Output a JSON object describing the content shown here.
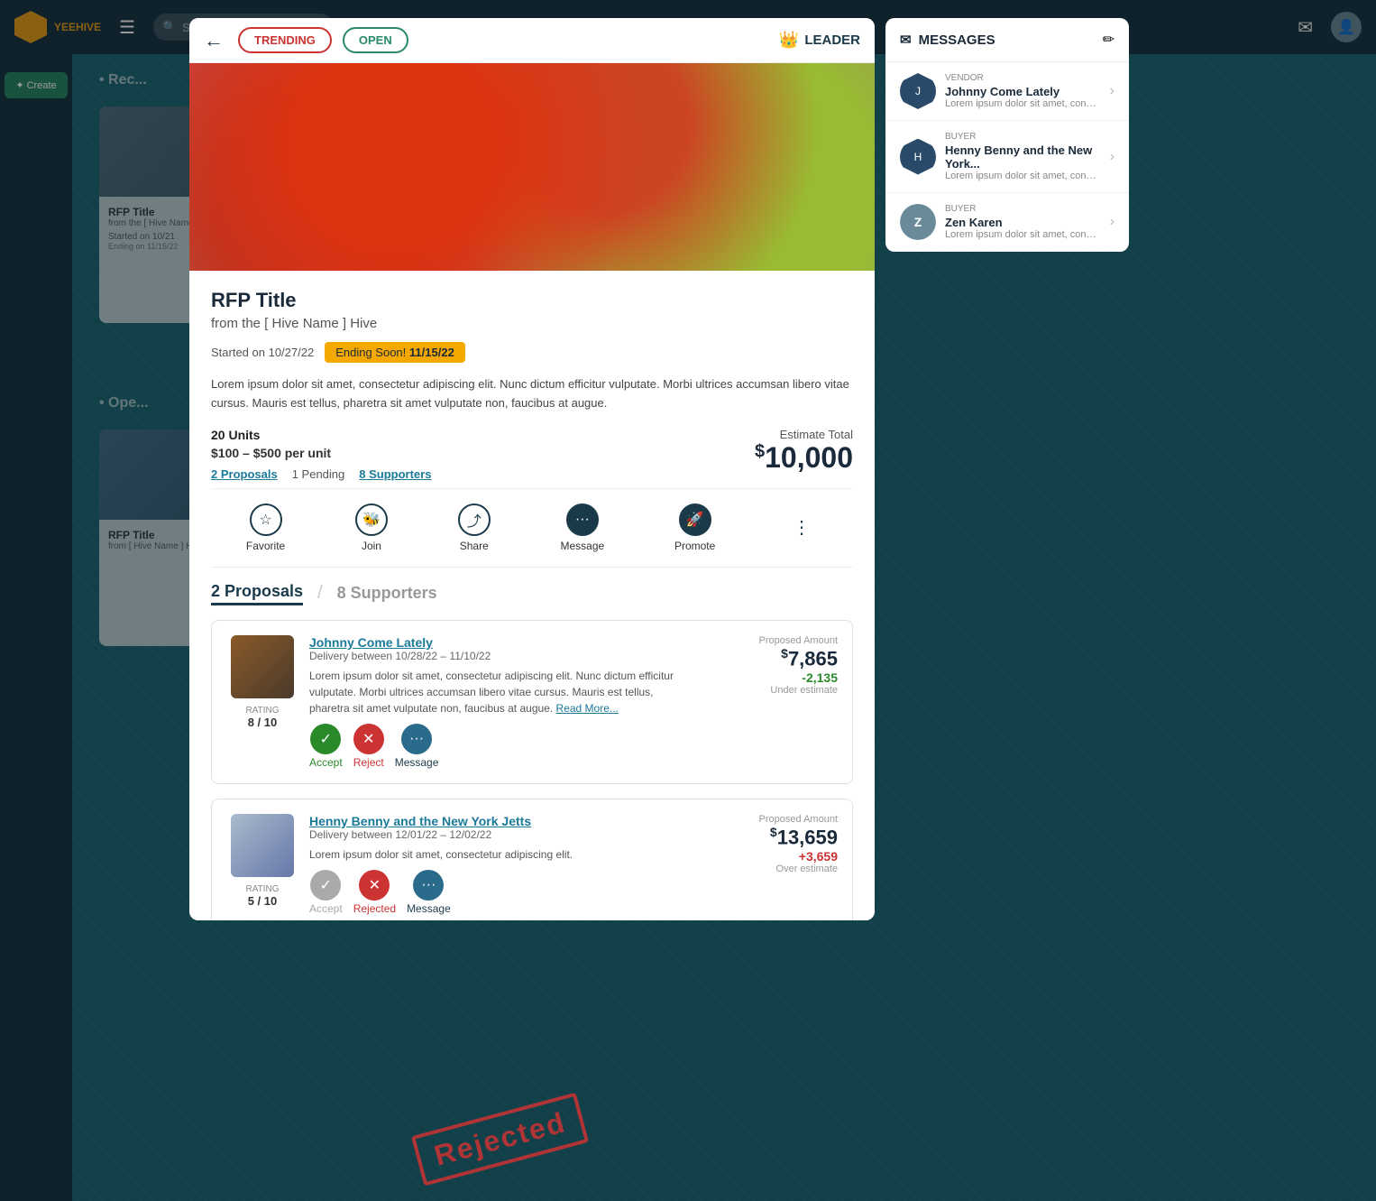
{
  "app": {
    "name": "YEEHIVE",
    "logo_icon": "🔶"
  },
  "topnav": {
    "search_placeholder": "Search...",
    "mail_icon": "✉",
    "user_icon": "👤"
  },
  "sidebar": {
    "create_label": "✦ Create"
  },
  "background": {
    "section1_label": "• Rec...",
    "section2_label": "• Ope...",
    "card1": {
      "title": "RFP Title",
      "subtitle": "from the [ Hive Name ] Hive",
      "started": "Started on 10/21",
      "ending": "Ending on 11/15/22"
    }
  },
  "modal": {
    "back_label": "←",
    "tab_trending": "TRENDING",
    "tab_open": "OPEN",
    "leader_label": "LEADER",
    "title": "RFP Title",
    "hive_name": "from the [ Hive Name ] Hive",
    "started": "Started on 10/27/22",
    "ending_soon": "Ending Soon!",
    "ending_date": "11/15/22",
    "description": "Lorem ipsum dolor sit amet, consectetur adipiscing elit. Nunc dictum efficitur vulputate. Morbi ultrices accumsan libero vitae cursus. Mauris est tellus, pharetra sit amet vulputate non, faucibus at augue.",
    "units": "20 Units",
    "price_range": "$100 – $500 per unit",
    "proposals_count": "2 Proposals",
    "pending_count": "1 Pending",
    "supporters_count": "8 Supporters",
    "estimate_label": "Estimate  Total",
    "estimate_amount": "10,000",
    "estimate_dollar": "$",
    "actions": [
      {
        "icon": "☆",
        "label": "Favorite"
      },
      {
        "icon": "🐝",
        "label": "Join"
      },
      {
        "icon": "⤴",
        "label": "Share"
      },
      {
        "icon": "···",
        "label": "Message"
      },
      {
        "icon": "🚀",
        "label": "Promote"
      }
    ],
    "more_icon": "⋮",
    "tab_proposals_label": "2 Proposals",
    "tab_supporters_label": "8 Supporters",
    "proposals": [
      {
        "id": 1,
        "vendor_name": "Johnny Come Lately",
        "delivery": "Delivery between 10/28/22 – 11/10/22",
        "description": "Lorem ipsum dolor sit amet, consectetur adipiscing elit. Nunc dictum efficitur vulputate. Morbi ultrices accumsan libero vitae cursus. Mauris est tellus, pharetra sit amet vulputate non, faucibus at augue.",
        "read_more": "Read More...",
        "rating_label": "RATING",
        "rating_value": "8 / 10",
        "proposed_label": "Proposed Amount",
        "proposed_amount": "7,865",
        "proposed_dollar": "$",
        "diff_value": "-2,135",
        "diff_label": "Under  estimate",
        "diff_type": "under",
        "actions": {
          "accept": "Accept",
          "reject": "Reject",
          "message": "Message"
        }
      },
      {
        "id": 2,
        "vendor_name": "Henny Benny and the New York Jetts",
        "delivery": "Delivery between 12/01/22 – 12/02/22",
        "description": "Lorem ipsum dolor sit amet, consectetur adipiscing elit.",
        "rating_label": "RATING",
        "rating_value": "5 / 10",
        "proposed_label": "Proposed Amount",
        "proposed_amount": "13,659",
        "proposed_dollar": "$",
        "diff_value": "+3,659",
        "diff_label": "Over  estimate",
        "diff_type": "over",
        "actions": {
          "accept": "Accept",
          "reject": "Rejected",
          "message": "Message"
        }
      }
    ]
  },
  "messages": {
    "title": "MESSAGES",
    "edit_icon": "✏",
    "items": [
      {
        "name": "Johnny Come Lately",
        "role": "VENDOR",
        "preview": "Lorem ipsum dolor sit amet, consectetur adipiscing elit nor petit allda sos ever...",
        "avatar_type": "hex",
        "avatar_initial": "J"
      },
      {
        "name": "Henny Benny and the New York...",
        "role": "BUYER",
        "preview": "Lorem ipsum dolor sit amet, consectetur adipiscing elit nor petit allda sos ever...",
        "avatar_type": "hex",
        "avatar_initial": "H"
      },
      {
        "name": "Zen Karen",
        "role": "BUYER",
        "preview": "Lorem ipsum dolor sit amet, consectetur adipiscing elit nor petit allda sos ever...",
        "avatar_type": "circle",
        "avatar_initial": "Z"
      }
    ]
  },
  "rejected_stamp": "Rejected"
}
